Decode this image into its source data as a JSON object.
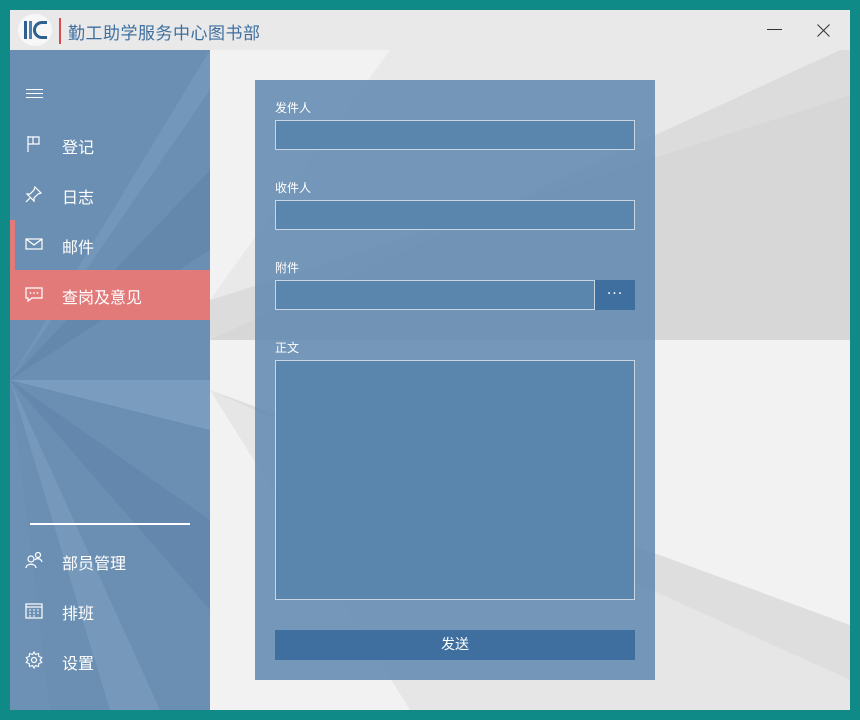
{
  "app": {
    "title": "勤工助学服务中心图书部"
  },
  "colors": {
    "frame": "#0f8a86",
    "sidebar": "#6b8fb2",
    "accent": "#e37a7a",
    "button": "#3f6f9f"
  },
  "sidebar": {
    "menu_icon": "hamburger-icon",
    "items": [
      {
        "label": "登记",
        "icon": "flag-icon"
      },
      {
        "label": "日志",
        "icon": "pin-icon"
      },
      {
        "label": "邮件",
        "icon": "mail-icon"
      },
      {
        "label": "查岗及意见",
        "icon": "comment-icon"
      }
    ],
    "bottom_items": [
      {
        "label": "部员管理",
        "icon": "people-icon"
      },
      {
        "label": "排班",
        "icon": "calendar-icon"
      },
      {
        "label": "设置",
        "icon": "gear-icon"
      }
    ]
  },
  "form": {
    "sender_label": "发件人",
    "sender_value": "",
    "recipient_label": "收件人",
    "recipient_value": "",
    "attachment_label": "附件",
    "attachment_value": "",
    "browse_label": "···",
    "body_label": "正文",
    "body_value": "",
    "send_label": "发送"
  }
}
